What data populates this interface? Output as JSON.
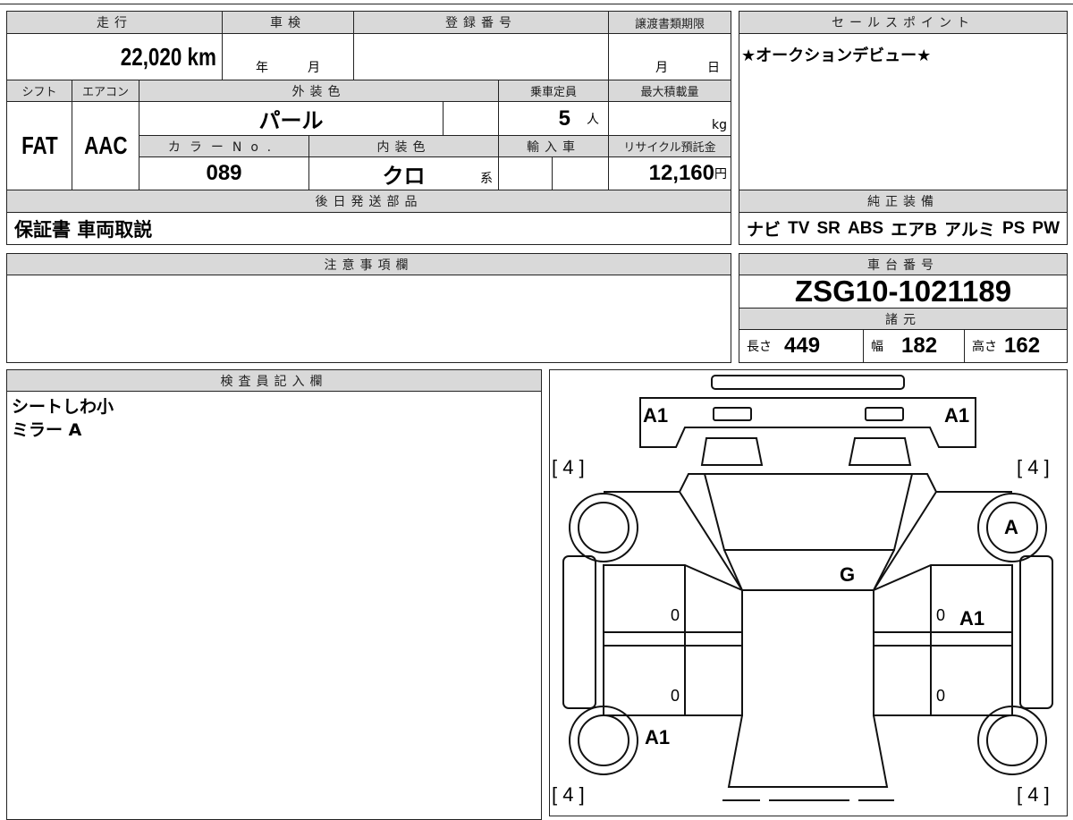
{
  "top_table": {
    "mileage_label": "走行",
    "mileage": "22,020 km",
    "shaken_label": "車検",
    "shaken_year": "年",
    "shaken_month": "月",
    "reg_label": "登録番号",
    "reg_value": "",
    "transfer_label": "譲渡書類期限",
    "transfer_month": "月",
    "transfer_day": "日",
    "shift_label": "シフト",
    "shift": "FAT",
    "ac_label": "エアコン",
    "ac": "AAC",
    "exterior_label": "外装色",
    "exterior": "パール",
    "capacity_label": "乗車定員",
    "capacity": "5",
    "capacity_unit": "人",
    "max_load_label": "最大積載量",
    "max_load_unit": "kg",
    "color_no_label": "カラーNo.",
    "color_no": "089",
    "interior_label": "内装色",
    "interior": "クロ",
    "interior_suffix": "系",
    "import_label": "輸入車",
    "recycle_label": "リサイクル預託金",
    "recycle": "12,160",
    "recycle_unit": "円",
    "later_parts_label": "後日発送部品",
    "later_parts": "保証書 車両取説"
  },
  "sales_point": {
    "label": "セールスポイント",
    "text": "★オークションデビュー★"
  },
  "equipment": {
    "label": "純正装備",
    "items": [
      "ナビ",
      "TV",
      "SR",
      "ABS",
      "エアB",
      "アルミ",
      "PS",
      "PW"
    ]
  },
  "notes": {
    "label": "注意事項欄"
  },
  "chassis": {
    "label": "車台番号",
    "value": "ZSG10-1021189",
    "spec_label": "諸元",
    "length_label": "長さ",
    "length": "449",
    "width_label": "幅",
    "width": "182",
    "height_label": "高さ",
    "height": "162"
  },
  "inspector": {
    "label": "検査員記入欄",
    "lines": [
      "シートしわ小",
      "ミラー A"
    ]
  },
  "diagram": {
    "labels": [
      "A1",
      "A1",
      "[ 4 ]",
      "[ 4 ]",
      "A",
      "G",
      "0",
      "0",
      "A1",
      "0",
      "0",
      "A1",
      "[ 4 ]",
      "[ 4 ]"
    ]
  }
}
